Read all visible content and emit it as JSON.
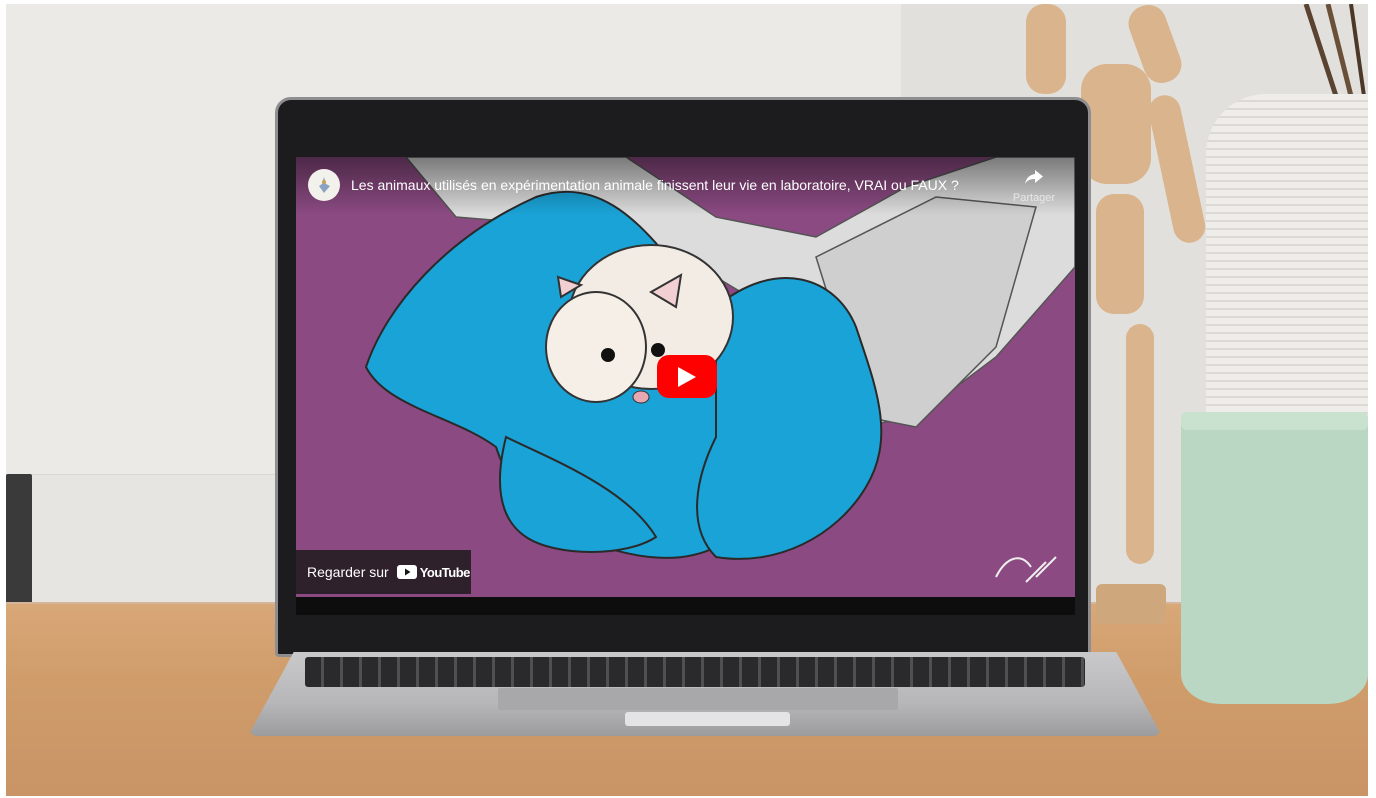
{
  "video": {
    "title": "Les animaux utilisés en expérimentation animale finissent leur vie en laboratoire, VRAI ou FAUX ?",
    "share_label": "Partager",
    "watch_on_label": "Regarder sur",
    "youtube_label": "YouTube",
    "background_color": "#8b4a82",
    "glove_color": "#1aa3d7",
    "play_button_color": "#ff0000"
  },
  "icons": {
    "channel": "channel-avatar-icon",
    "share": "share-arrow-icon",
    "play": "play-icon",
    "youtube": "youtube-logo-icon"
  }
}
